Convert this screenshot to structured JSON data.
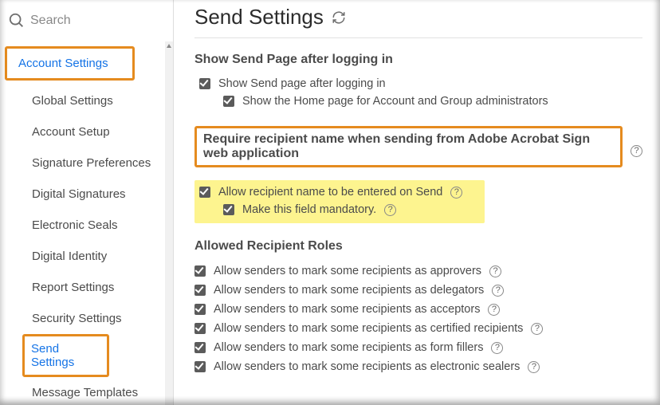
{
  "search": {
    "placeholder": "Search"
  },
  "sidebar": {
    "header": "Account Settings",
    "items": [
      {
        "label": "Global Settings"
      },
      {
        "label": "Account Setup"
      },
      {
        "label": "Signature Preferences"
      },
      {
        "label": "Digital Signatures"
      },
      {
        "label": "Electronic Seals"
      },
      {
        "label": "Digital Identity"
      },
      {
        "label": "Report Settings"
      },
      {
        "label": "Security Settings"
      },
      {
        "label": "Send Settings"
      },
      {
        "label": "Message Templates"
      }
    ]
  },
  "page": {
    "title": "Send Settings"
  },
  "sections": {
    "showSend": {
      "title": "Show Send Page after logging in",
      "opt1": "Show Send page after logging in",
      "opt2": "Show the Home page for Account and Group administrators"
    },
    "requireName": {
      "title": "Require recipient name when sending from Adobe Acrobat Sign web application",
      "opt1": "Allow recipient name to be entered on Send",
      "opt2": "Make this field mandatory."
    },
    "roles": {
      "title": "Allowed Recipient Roles",
      "opts": [
        "Allow senders to mark some recipients as approvers",
        "Allow senders to mark some recipients as delegators",
        "Allow senders to mark some recipients as acceptors",
        "Allow senders to mark some recipients as certified recipients",
        "Allow senders to mark some recipients as form fillers",
        "Allow senders to mark some recipients as electronic sealers"
      ]
    }
  }
}
